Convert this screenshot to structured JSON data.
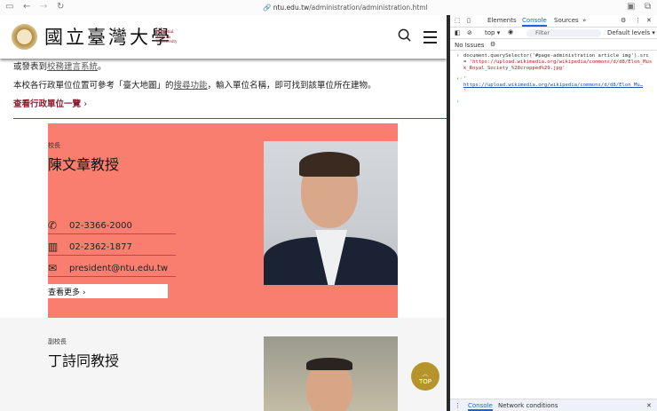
{
  "browser": {
    "url_host": "ntu.edu.tw",
    "url_path": "/administration/administration.html"
  },
  "header": {
    "logo_cn": "國立臺灣大學",
    "logo_en": [
      "National",
      "Taiwan",
      "University"
    ]
  },
  "content": {
    "line1_prefix": "或發表到",
    "line1_link": "校務建言系統",
    "line1_suffix": "。",
    "line2_prefix": "本校各行政單位位置可參考「臺大地圖」的",
    "line2_link": "搜尋功能",
    "line2_suffix": "，輸入單位名稱，即可找到該單位所在建物。",
    "units_link": "查看行政單位一覽"
  },
  "president": {
    "role": "校長",
    "name": "陳文章教授",
    "phone": "02-3366-2000",
    "fax": "02-2362-1877",
    "email": "president@ntu.edu.tw",
    "more": "查看更多"
  },
  "vice_president": {
    "role": "副校長",
    "name": "丁詩同教授"
  },
  "top_button": "TOP",
  "devtools": {
    "tabs": [
      "Elements",
      "Console",
      "Sources"
    ],
    "context": "top",
    "filter_placeholder": "Filter",
    "levels": "Default levels",
    "issues": "No Issues",
    "command": "document.querySelector('#page-administration article img').src = ",
    "command_string": "'https://upload.wikimedia.org/wikipedia/commons/d/d8/Elon_Musk_Royal_Society_%28cropped%29.jpg'",
    "result": "https://upload.wikimedia.org/wikipedia/commons/d/d8/Elon_Mu…",
    "drawer_tabs": [
      "Console",
      "Network conditions"
    ]
  },
  "colors": {
    "card": "#fa7e6f",
    "accent": "#8b1a2b",
    "top_button": "#b5952b"
  }
}
